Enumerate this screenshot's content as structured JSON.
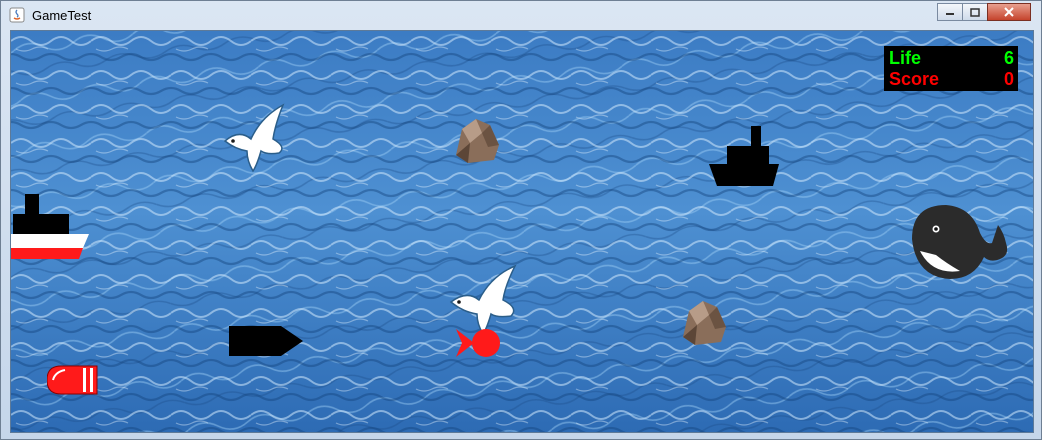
{
  "window": {
    "title": "GameTest"
  },
  "hud": {
    "life_label": "Life",
    "life_value": "6",
    "score_label": "Score",
    "score_value": "0",
    "life_color": "#00ff00",
    "score_color": "#ff0000"
  },
  "colors": {
    "water_light": "#8fc3ec",
    "water_mid": "#3f7fc4",
    "water_dark": "#1f4f8c",
    "enemy_red": "#ff1a1a",
    "sprite_black": "#000000"
  },
  "sprites": [
    {
      "name": "seagull-icon"
    },
    {
      "name": "rock-icon"
    },
    {
      "name": "black-steamship-icon"
    },
    {
      "name": "red-white-ship-icon"
    },
    {
      "name": "whale-icon"
    },
    {
      "name": "seagull-icon"
    },
    {
      "name": "black-submarine-icon"
    },
    {
      "name": "red-fish-icon"
    },
    {
      "name": "rock-icon"
    },
    {
      "name": "red-torpedo-icon"
    }
  ]
}
